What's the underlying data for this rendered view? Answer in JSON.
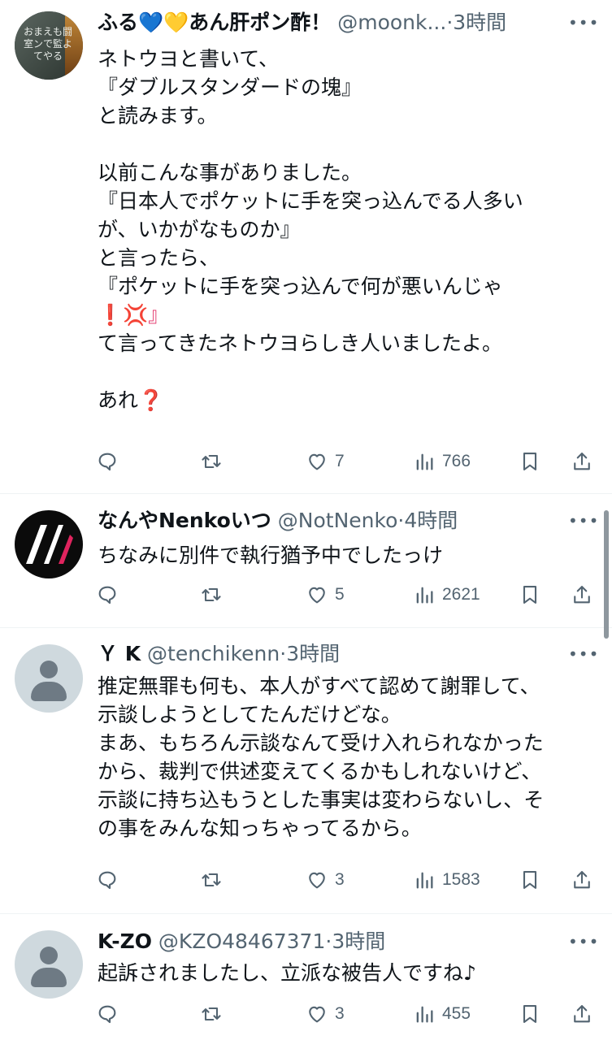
{
  "tweets": [
    {
      "name": "ふる💙💛あん肝ポン酢！",
      "handle": "@moonk...",
      "dot": "·",
      "time": "3時間",
      "more": "•••",
      "avatar_text": "おまえも闘室ンで監よてやる",
      "lines": [
        "ネトウヨと書いて、",
        "『ダブルスタンダードの塊』",
        "と読みます。",
        "",
        "以前こんな事がありました。",
        "『日本人でポケットに手を突っ込んでる人多い",
        "が、いかがなものか』",
        "と言ったら、",
        "『ポケットに手を突っ込んで何が悪いんじゃ",
        "❗💢』",
        "て言ってきたネトウヨらしき人いましたよ。",
        "",
        "あれ❓"
      ],
      "likes": "7",
      "views": "766"
    },
    {
      "name": "なんやNenkoいつ",
      "handle": "@NotNenko",
      "dot": "·",
      "time": "4時間",
      "more": "•••",
      "lines": [
        "ちなみに別件で執行猶予中でしたっけ"
      ],
      "likes": "5",
      "views": "2621"
    },
    {
      "name": "Ｙ K",
      "handle": "@tenchikenn",
      "dot": "·",
      "time": "3時間",
      "more": "•••",
      "lines": [
        "推定無罪も何も、本人がすべて認めて謝罪して、",
        "示談しようとしてたんだけどな。",
        "まあ、もちろん示談なんて受け入れられなかった",
        "から、裁判で供述変えてくるかもしれないけど、",
        "示談に持ち込もうとした事実は変わらないし、そ",
        "の事をみんな知っちゃってるから。"
      ],
      "likes": "3",
      "views": "1583"
    },
    {
      "name": "K-ZO",
      "handle": "@KZO48467371",
      "dot": "·",
      "time": "3時間",
      "more": "•••",
      "lines": [
        "起訴されましたし、立派な被告人ですね♪"
      ],
      "likes": "3",
      "views": "455"
    }
  ],
  "icons": [
    "reply-icon",
    "retweet-icon",
    "like-icon",
    "views-icon",
    "bookmark-icon",
    "share-icon"
  ],
  "colors": {
    "text": "#0f1419",
    "secondary": "#536471",
    "divider": "#eff3f4",
    "emphasis_red": "#e0245e"
  }
}
